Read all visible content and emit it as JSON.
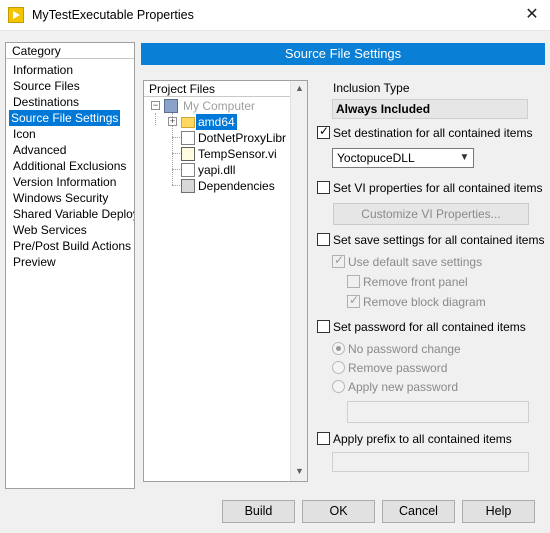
{
  "window": {
    "title": "MyTestExecutable Properties",
    "close_glyph": "✕"
  },
  "category": {
    "header": "Category",
    "items": [
      "Information",
      "Source Files",
      "Destinations",
      "Source File Settings",
      "Icon",
      "Advanced",
      "Additional Exclusions",
      "Version Information",
      "Windows Security",
      "Shared Variable Deploy",
      "Web Services",
      "Pre/Post Build Actions",
      "Preview"
    ],
    "selected": "Source File Settings"
  },
  "banner": "Source File Settings",
  "project_files": {
    "header": "Project Files",
    "root": "My Computer",
    "items": [
      "amd64",
      "DotNetProxyLibr",
      "TempSensor.vi",
      "yapi.dll",
      "Dependencies"
    ],
    "selected": "amd64"
  },
  "settings": {
    "inclusion_type_label": "Inclusion Type",
    "inclusion_type_value": "Always Included",
    "set_destination_label": "Set destination for all contained items",
    "set_destination_checked": true,
    "destination_value": "YoctopuceDLL",
    "set_vi_properties_label": "Set VI properties for all contained items",
    "customize_vi_button": "Customize VI Properties...",
    "set_save_label": "Set save settings for all contained items",
    "use_default_save_label": "Use default save settings",
    "remove_front_panel_label": "Remove front panel",
    "remove_block_diagram_label": "Remove block diagram",
    "set_password_label": "Set password for all contained items",
    "no_password_label": "No password change",
    "remove_password_label": "Remove password",
    "apply_password_label": "Apply new password",
    "apply_prefix_label": "Apply prefix to all contained items"
  },
  "buttons": {
    "build": "Build",
    "ok": "OK",
    "cancel": "Cancel",
    "help": "Help"
  },
  "icons": {
    "app": "labview-app-icon",
    "scroll_up": "▲",
    "scroll_down": "▼",
    "dropdown": "▼",
    "expand": "+",
    "collapse": "−"
  }
}
